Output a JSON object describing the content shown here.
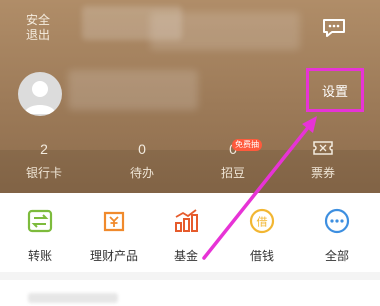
{
  "header": {
    "safe_exit_line1": "安全",
    "safe_exit_line2": "退出",
    "settings_label": "设置"
  },
  "stats": [
    {
      "value": "2",
      "label": "银行卡"
    },
    {
      "value": "0",
      "label": "待办"
    },
    {
      "value": "0",
      "label": "招豆",
      "badge": "免费抽"
    },
    {
      "value": "",
      "label": "票券"
    }
  ],
  "shortcuts": [
    {
      "label": "转账",
      "icon": "transfer-icon",
      "color": "#7dbb3c"
    },
    {
      "label": "理财产品",
      "icon": "wealth-product-icon",
      "color": "#f08a2c"
    },
    {
      "label": "基金",
      "icon": "fund-chart-icon",
      "color": "#e65b2c"
    },
    {
      "label": "借钱",
      "icon": "borrow-money-icon",
      "color": "#f2b632"
    },
    {
      "label": "全部",
      "icon": "more-dots-icon",
      "color": "#3d8fe0"
    }
  ],
  "colors": {
    "header_bg": "#a3805e",
    "highlight": "#e733d6"
  }
}
